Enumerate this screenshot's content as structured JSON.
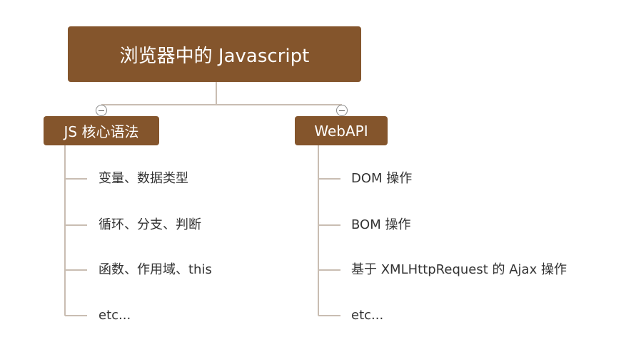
{
  "root": {
    "label": "浏览器中的 Javascript"
  },
  "branches": [
    {
      "label": "JS 核心语法",
      "items": [
        "变量、数据类型",
        "循环、分支、判断",
        "函数、作用域、this",
        "etc..."
      ]
    },
    {
      "label": "WebAPI",
      "items": [
        "DOM 操作",
        "BOM 操作",
        "基于 XMLHttpRequest 的 Ajax 操作",
        "etc..."
      ]
    }
  ],
  "colors": {
    "node_fill": "#84552c",
    "node_text": "#ffffff",
    "connector": "#c9bdb2",
    "leaf_text": "#333333"
  }
}
